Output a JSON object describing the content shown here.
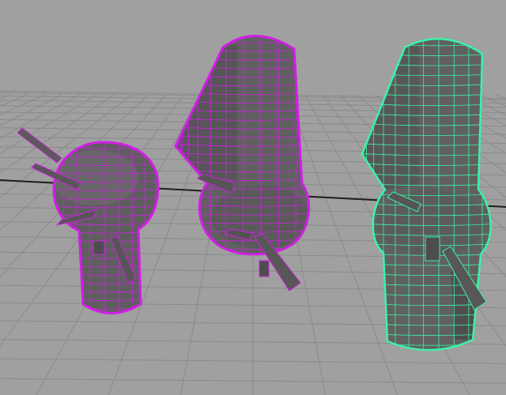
{
  "viewport": {
    "background": "#a0a0a0",
    "grid_color": "#8a8a8a",
    "grid_axis_color": "#1e1e1e",
    "shape_fill": "#5e5e5e",
    "shape_fill_light": "#6d6d6d",
    "shape_fill_dark": "#4c4c4c"
  },
  "objects": [
    {
      "id": "object-1",
      "state": "selected",
      "wire_color": "#d21ee6"
    },
    {
      "id": "object-2",
      "state": "selected",
      "wire_color": "#d21ee6"
    },
    {
      "id": "object-3",
      "state": "lead-selected",
      "wire_color": "#3cf2a8"
    }
  ]
}
